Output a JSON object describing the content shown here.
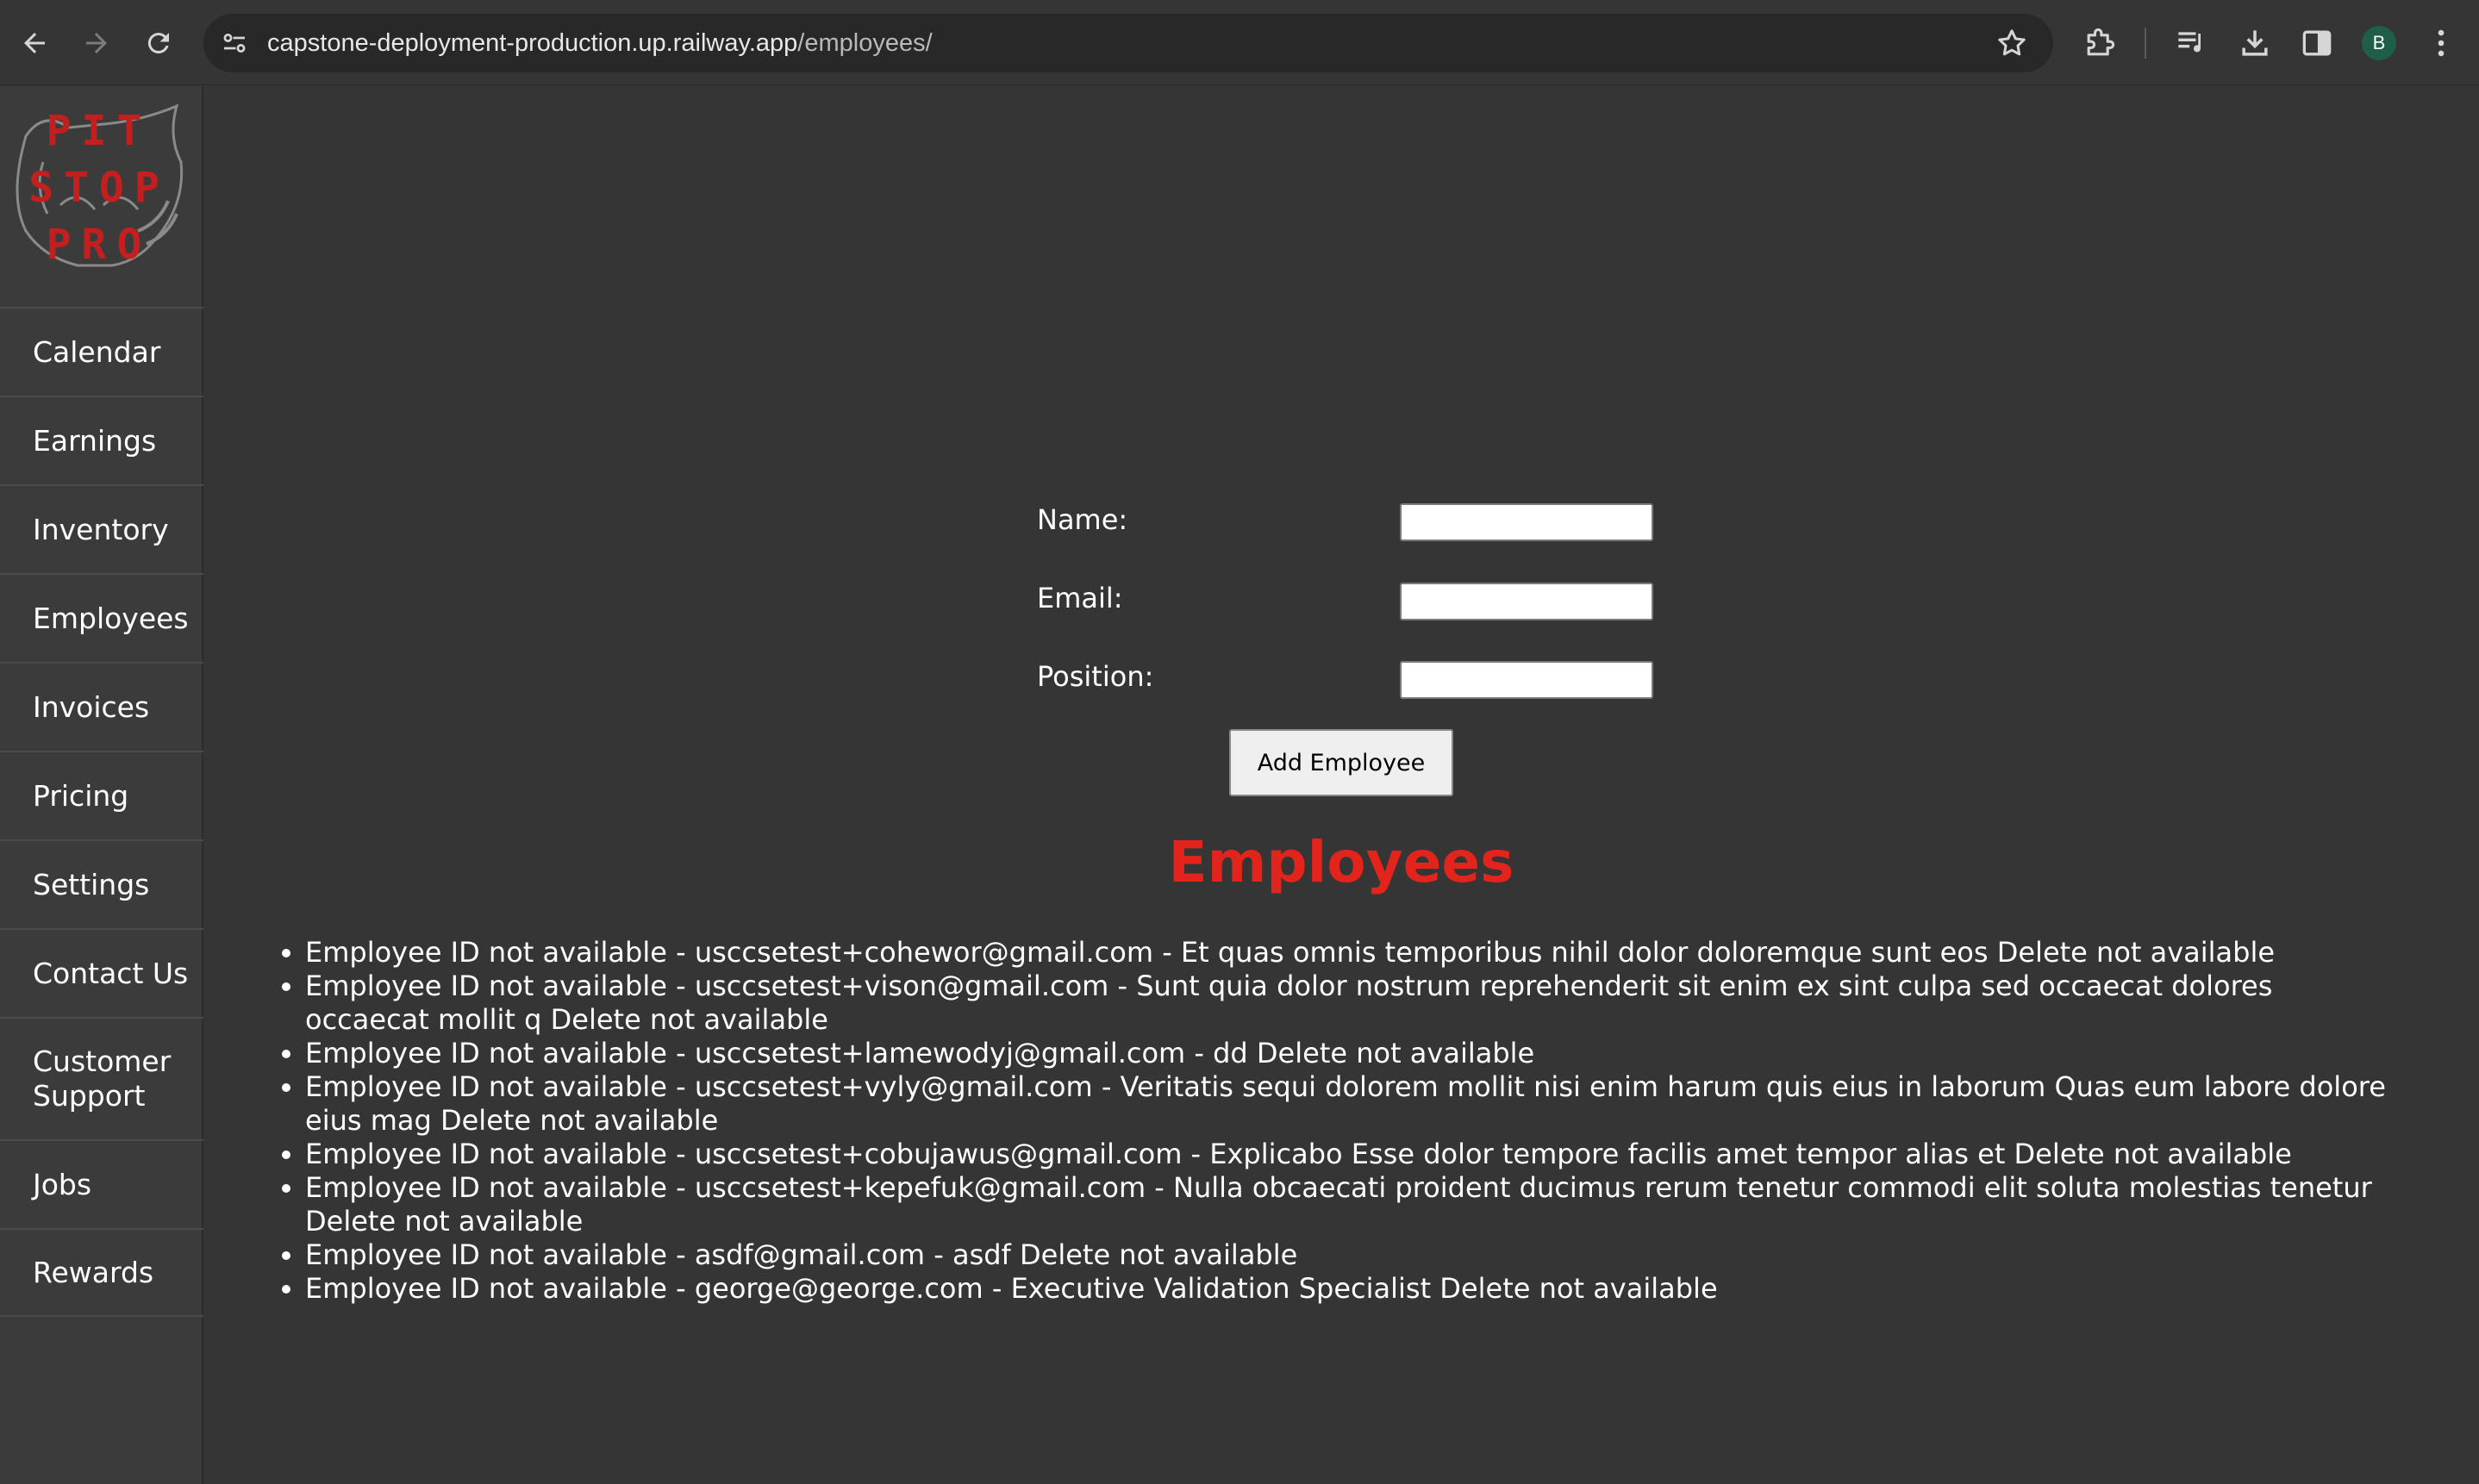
{
  "browser": {
    "url_host": "capstone-deployment-production.up.railway.app",
    "url_path": "/employees/",
    "profile_initial": "B"
  },
  "sidebar": {
    "logo_lines": [
      "PIT",
      "STOP",
      "PRO"
    ],
    "items": [
      {
        "label": "Calendar"
      },
      {
        "label": "Earnings"
      },
      {
        "label": "Inventory"
      },
      {
        "label": "Employees"
      },
      {
        "label": "Invoices"
      },
      {
        "label": "Pricing"
      },
      {
        "label": "Settings"
      },
      {
        "label": "Contact Us"
      },
      {
        "label": "Customer Support"
      },
      {
        "label": "Jobs"
      },
      {
        "label": "Rewards"
      }
    ]
  },
  "form": {
    "name_label": "Name:",
    "email_label": "Email:",
    "position_label": "Position:",
    "name_value": "",
    "email_value": "",
    "position_value": "",
    "submit_label": "Add Employee"
  },
  "heading": "Employees",
  "employees": [
    "Employee ID not available - usccsetest+cohewor@gmail.com - Et quas omnis temporibus nihil dolor doloremque sunt eos Delete not available",
    "Employee ID not available - usccsetest+vison@gmail.com - Sunt quia dolor nostrum reprehenderit sit enim ex sint culpa sed occaecat dolores occaecat mollit q Delete not available",
    "Employee ID not available - usccsetest+lamewodyj@gmail.com - dd Delete not available",
    "Employee ID not available - usccsetest+vyly@gmail.com - Veritatis sequi dolorem mollit nisi enim harum quis eius in laborum Quas eum labore dolore eius mag Delete not available",
    "Employee ID not available - usccsetest+cobujawus@gmail.com - Explicabo Esse dolor tempore facilis amet tempor alias et Delete not available",
    "Employee ID not available - usccsetest+kepefuk@gmail.com - Nulla obcaecati proident ducimus rerum tenetur commodi elit soluta molestias tenetur Delete not available",
    "Employee ID not available - asdf@gmail.com - asdf Delete not available",
    "Employee ID not available - george@george.com - Executive Validation Specialist Delete not available"
  ]
}
